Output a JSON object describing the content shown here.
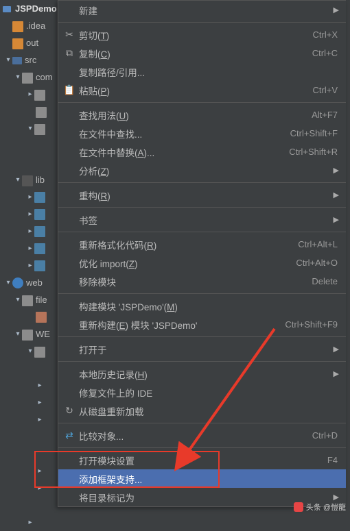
{
  "project": {
    "root": "JSPDemo",
    "nodes": {
      "idea": ".idea",
      "out": "out",
      "src": "src",
      "com": "com",
      "lib": "lib",
      "web": "web",
      "file": "file",
      "we": "WE"
    }
  },
  "menu": {
    "new": "新建",
    "cut": {
      "label": "剪切(",
      "mnemonic": "T",
      "suffix": ")",
      "shortcut": "Ctrl+X"
    },
    "copy": {
      "label": "复制(",
      "mnemonic": "C",
      "suffix": ")",
      "shortcut": "Ctrl+C"
    },
    "copy_path": "复制路径/引用...",
    "paste": {
      "label": "粘贴(",
      "mnemonic": "P",
      "suffix": ")",
      "shortcut": "Ctrl+V"
    },
    "find_usages": {
      "label": "查找用法(",
      "mnemonic": "U",
      "suffix": ")",
      "shortcut": "Alt+F7"
    },
    "find_in_files": {
      "label": "在文件中查找...",
      "shortcut": "Ctrl+Shift+F"
    },
    "replace_in_files": {
      "label": "在文件中替换(",
      "mnemonic": "A",
      "suffix": ")...",
      "shortcut": "Ctrl+Shift+R"
    },
    "analyze": {
      "label": "分析(",
      "mnemonic": "Z",
      "suffix": ")"
    },
    "refactor": {
      "label": "重构(",
      "mnemonic": "R",
      "suffix": ")"
    },
    "bookmarks": "书签",
    "reformat": {
      "label": "重新格式化代码(",
      "mnemonic": "R",
      "suffix": ")",
      "shortcut": "Ctrl+Alt+L"
    },
    "optimize_imports": {
      "label": "优化 import(",
      "mnemonic": "Z",
      "suffix": ")",
      "shortcut": "Ctrl+Alt+O"
    },
    "remove_module": {
      "label": "移除模块",
      "shortcut": "Delete"
    },
    "make_module": {
      "label_pre": "构建模块 'JSPDemo'(",
      "mnemonic": "M",
      "suffix": ")"
    },
    "rebuild_module": {
      "label_pre": "重新构建(",
      "mnemonic": "E",
      "suffix": ") 模块 'JSPDemo'",
      "shortcut": "Ctrl+Shift+F9"
    },
    "open_in": "打开于",
    "local_history": {
      "label": "本地历史记录(",
      "mnemonic": "H",
      "suffix": ")"
    },
    "repair_ide": "修复文件上的 IDE",
    "reload_disk": "从磁盘重新加载",
    "compare_with": {
      "label": "比较对象...",
      "shortcut": "Ctrl+D"
    },
    "module_settings": {
      "label": "打开模块设置",
      "shortcut": "F4"
    },
    "add_framework": "添加框架支持...",
    "mark_dir_as": "将目录标记为"
  },
  "watermark": "头条 @愷龍"
}
